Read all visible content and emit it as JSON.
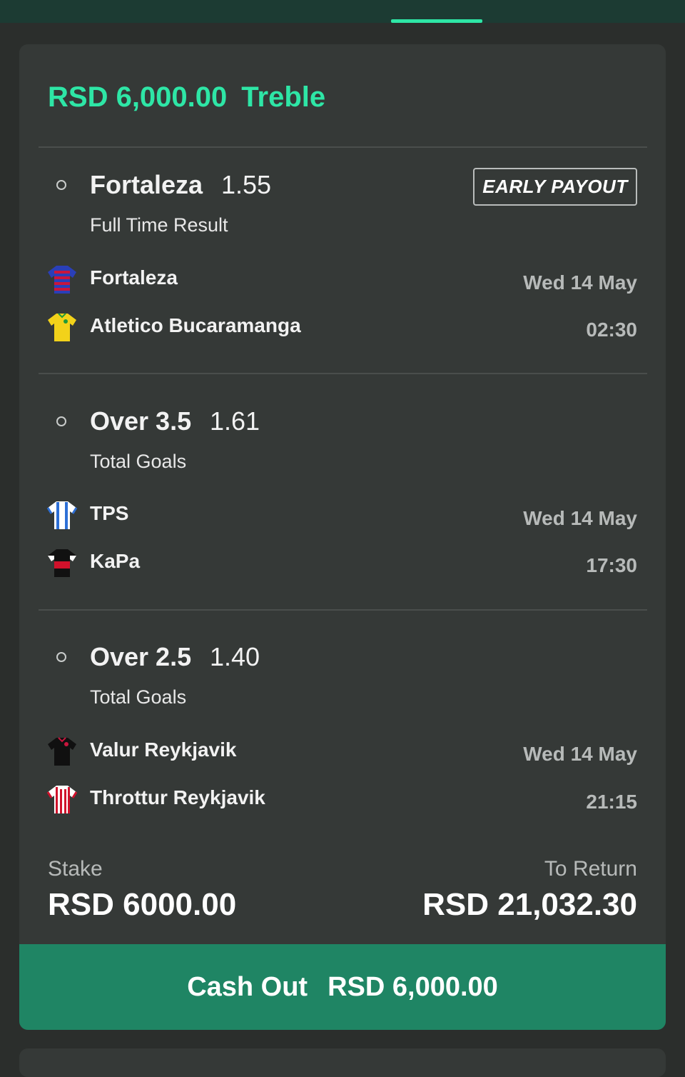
{
  "header": {
    "accent_color": "#2ee6a6"
  },
  "bet": {
    "amount": "RSD 6,000.00",
    "type": "Treble",
    "early_payout_label": "EARLY PAYOUT",
    "selections": [
      {
        "name": "Fortaleza",
        "odds": "1.55",
        "market": "Full Time Result",
        "home": "Fortaleza",
        "away": "Atletico Bucaramanga",
        "date": "Wed 14 May",
        "time": "02:30",
        "home_kit": "striped-blue-red-kit-icon",
        "away_kit": "yellow-kit-icon"
      },
      {
        "name": "Over 3.5",
        "odds": "1.61",
        "market": "Total Goals",
        "home": "TPS",
        "away": "KaPa",
        "date": "Wed 14 May",
        "time": "17:30",
        "home_kit": "blue-white-striped-kit-icon",
        "away_kit": "black-red-kit-icon"
      },
      {
        "name": "Over 2.5",
        "odds": "1.40",
        "market": "Total Goals",
        "home": "Valur Reykjavik",
        "away": "Throttur Reykjavik",
        "date": "Wed 14 May",
        "time": "21:15",
        "home_kit": "black-kit-icon",
        "away_kit": "red-white-striped-kit-icon"
      }
    ],
    "stake_label": "Stake",
    "stake_value": "RSD 6000.00",
    "return_label": "To Return",
    "return_value": "RSD 21,032.30",
    "cashout_label": "Cash Out",
    "cashout_value": "RSD 6,000.00",
    "cashout_color": "#1f8564"
  }
}
